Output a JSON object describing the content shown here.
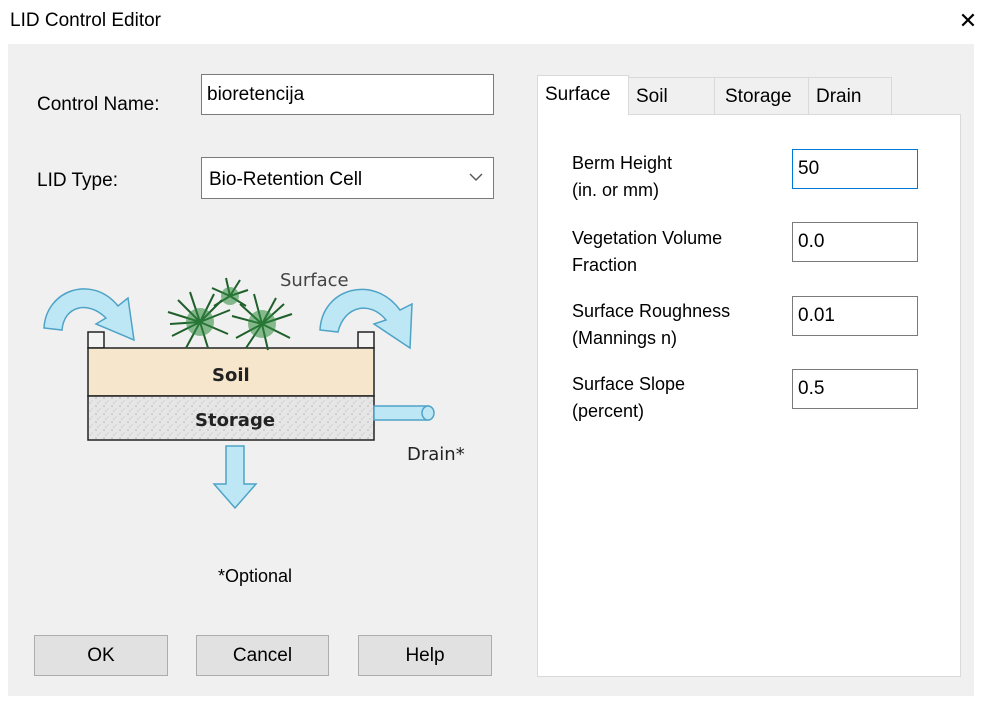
{
  "window": {
    "title": "LID Control Editor"
  },
  "form": {
    "control_name_label": "Control Name:",
    "control_name_value": "bioretencija",
    "lid_type_label": "LID Type:",
    "lid_type_value": "Bio-Retention Cell"
  },
  "diagram": {
    "surface_label": "Surface",
    "soil_label": "Soil",
    "storage_label": "Storage",
    "drain_label": "Drain*",
    "optional_note": "*Optional"
  },
  "buttons": {
    "ok": "OK",
    "cancel": "Cancel",
    "help": "Help"
  },
  "tabs": [
    {
      "label": "Surface",
      "active": true
    },
    {
      "label": "Soil",
      "active": false
    },
    {
      "label": "Storage",
      "active": false
    },
    {
      "label": "Drain",
      "active": false
    }
  ],
  "surface_fields": [
    {
      "label_line1": "Berm Height",
      "label_line2": "(in. or mm)",
      "value": "50"
    },
    {
      "label_line1": "Vegetation Volume",
      "label_line2": "Fraction",
      "value": "0.0"
    },
    {
      "label_line1": "Surface Roughness",
      "label_line2": "(Mannings n)",
      "value": "0.01"
    },
    {
      "label_line1": "Surface Slope",
      "label_line2": "(percent)",
      "value": "0.5"
    }
  ],
  "colors": {
    "dialog_bg": "#f0f0f0",
    "arrow_fill": "#bde7f5",
    "arrow_stroke": "#4ea3c7",
    "soil_fill": "#f5e6cc",
    "storage_fill": "#e8e8e8",
    "focus_border": "#0078d7"
  }
}
